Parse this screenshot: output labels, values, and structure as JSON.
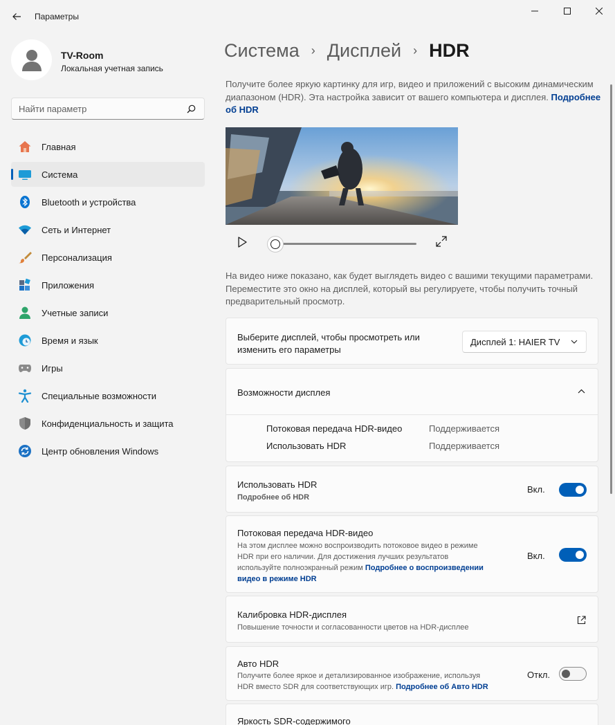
{
  "window": {
    "title": "Параметры"
  },
  "profile": {
    "name": "TV-Room",
    "account_type": "Локальная учетная запись"
  },
  "search": {
    "placeholder": "Найти параметр"
  },
  "sidebar": {
    "items": [
      {
        "label": "Главная",
        "icon": "home-icon"
      },
      {
        "label": "Система",
        "icon": "system-icon",
        "active": true
      },
      {
        "label": "Bluetooth и устройства",
        "icon": "bluetooth-icon"
      },
      {
        "label": "Сеть и Интернет",
        "icon": "wifi-icon"
      },
      {
        "label": "Персонализация",
        "icon": "brush-icon"
      },
      {
        "label": "Приложения",
        "icon": "apps-icon"
      },
      {
        "label": "Учетные записи",
        "icon": "accounts-icon"
      },
      {
        "label": "Время и язык",
        "icon": "time-language-icon"
      },
      {
        "label": "Игры",
        "icon": "gamepad-icon"
      },
      {
        "label": "Специальные возможности",
        "icon": "accessibility-icon"
      },
      {
        "label": "Конфиденциальность и защита",
        "icon": "shield-icon"
      },
      {
        "label": "Центр обновления Windows",
        "icon": "update-icon"
      }
    ]
  },
  "breadcrumb": {
    "items": [
      "Система",
      "Дисплей"
    ],
    "current": "HDR",
    "separator": "›"
  },
  "intro": {
    "text": "Получите более яркую картинку для игр, видео и приложений с высоким динамическим диапазоном (HDR). Эта настройка зависит от вашего компьютера и дисплея. ",
    "link": "Подробнее об HDR"
  },
  "video": {
    "progress": 0
  },
  "preview_note": "На видео ниже показано, как будет выглядеть видео с вашими текущими параметрами. Переместите это окно на дисплей, который вы регулируете, чтобы получить точный предварительный просмотр.",
  "display_select": {
    "label_line1": "Выберите дисплей, чтобы просмотреть или",
    "label_line2": "изменить его параметры",
    "selected": "Дисплей 1: HAIER TV"
  },
  "capabilities": {
    "title": "Возможности дисплея",
    "rows": [
      {
        "name": "Потоковая передача HDR-видео",
        "value": "Поддерживается"
      },
      {
        "name": "Использовать HDR",
        "value": "Поддерживается"
      }
    ]
  },
  "use_hdr": {
    "title": "Использовать HDR",
    "link": "Подробнее об HDR",
    "state": "Вкл.",
    "on": true
  },
  "hdr_streaming": {
    "title": "Потоковая передача HDR-видео",
    "desc_line1": "На этом дисплее можно воспроизводить потоковое видео в режиме",
    "desc_line2": "HDR при его наличии. Для достижения лучших результатов",
    "desc_line3": "используйте полноэкранный режим ",
    "link_line1": "Подробнее о воспроизведении",
    "link_line2": "видео в режиме HDR",
    "state": "Вкл.",
    "on": true
  },
  "calibration": {
    "title": "Калибровка HDR-дисплея",
    "desc": "Повышение точности и согласованности цветов на HDR-дисплее"
  },
  "auto_hdr": {
    "title": "Авто HDR",
    "desc_line1": "Получите более яркое и детализированное изображение, используя",
    "desc_line2": "HDR вместо SDR для соответствующих игр. ",
    "link": "Подробнее об Авто HDR",
    "state": "Откл.",
    "on": false
  },
  "sdr_brightness": {
    "title": "Яркость SDR-содержимого"
  },
  "colors": {
    "accent": "#005fb8",
    "link": "#003e92"
  }
}
